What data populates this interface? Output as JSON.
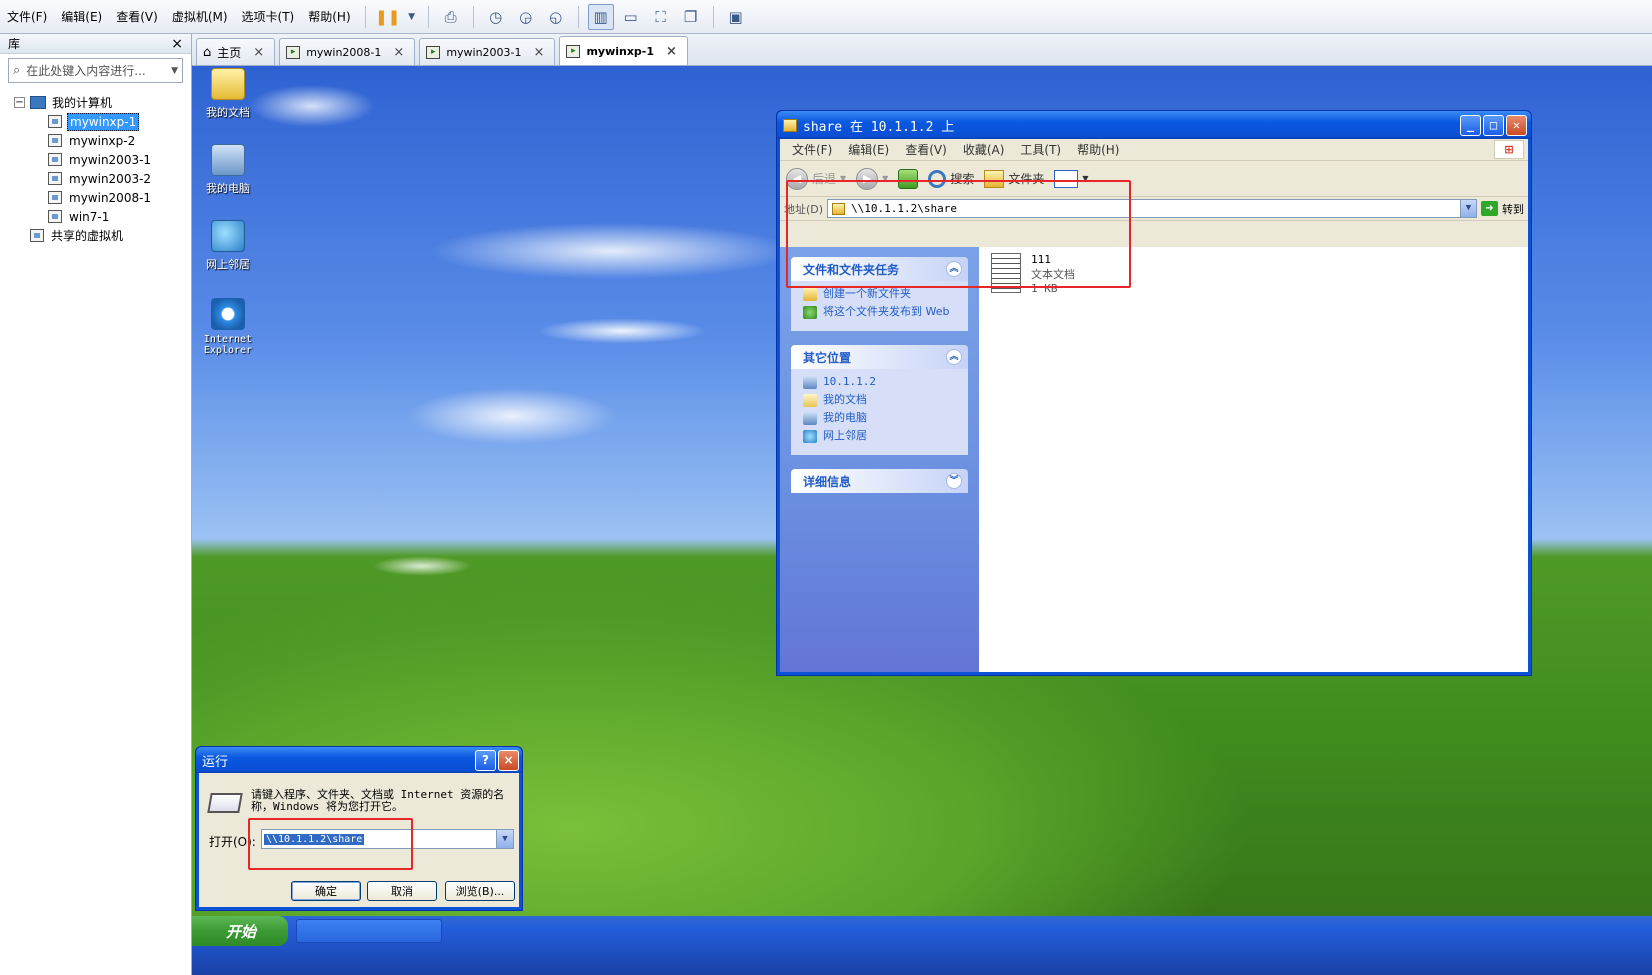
{
  "menubar": {
    "items": [
      "文件(F)",
      "编辑(E)",
      "查看(V)",
      "虚拟机(M)",
      "选项卡(T)",
      "帮助(H)"
    ]
  },
  "library": {
    "title": "库",
    "close": "×",
    "search_placeholder": "在此处键入内容进行...",
    "tree": {
      "root": "我的计算机",
      "root_toggle": "−",
      "vms": [
        "mywinxp-1",
        "mywinxp-2",
        "mywin2003-1",
        "mywin2003-2",
        "mywin2008-1",
        "win7-1"
      ],
      "selected": "mywinxp-1",
      "shared": "共享的虚拟机"
    }
  },
  "tabs": [
    {
      "label": "主页",
      "close": "×"
    },
    {
      "label": "mywin2008-1",
      "close": "×"
    },
    {
      "label": "mywin2003-1",
      "close": "×"
    },
    {
      "label": "mywinxp-1",
      "close": "×",
      "active": true
    }
  ],
  "desktop_icons": [
    "我的文档",
    "我的电脑",
    "网上邻居",
    "Internet Explorer"
  ],
  "explorer": {
    "title": "share 在 10.1.1.2 上",
    "menu": [
      "文件(F)",
      "编辑(E)",
      "查看(V)",
      "收藏(A)",
      "工具(T)",
      "帮助(H)"
    ],
    "toolbar": {
      "back": "后退",
      "search": "搜索",
      "folders": "文件夹"
    },
    "address_label": "地址(D)",
    "address_value": "\\\\10.1.1.2\\share",
    "go_label": "转到",
    "tasks_panel": {
      "title": "文件和文件夹任务",
      "links": [
        "创建一个新文件夹",
        "将这个文件夹发布到 Web"
      ]
    },
    "other_places": {
      "title": "其它位置",
      "links": [
        "10.1.1.2",
        "我的文档",
        "我的电脑",
        "网上邻居"
      ]
    },
    "details": {
      "title": "详细信息"
    },
    "file": {
      "name": "111",
      "type": "文本文档",
      "size": "1 KB"
    }
  },
  "run_dialog": {
    "title": "运行",
    "help": "?",
    "close": "×",
    "message": "请键入程序、文件夹、文档或 Internet 资源的名称，Windows 将为您打开它。",
    "open_label": "打开(O):",
    "open_value": "\\\\10.1.1.2\\share",
    "ok": "确定",
    "cancel": "取消",
    "browse": "浏览(B)..."
  },
  "taskbar": {
    "start": "开始"
  },
  "colors": {
    "annotation": "#e8262a",
    "xp_blue": "#0a52d6",
    "selection": "#3399ff"
  }
}
